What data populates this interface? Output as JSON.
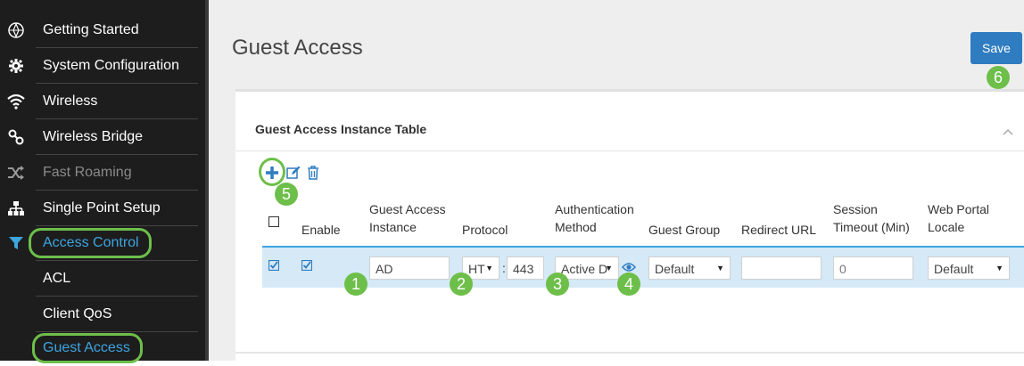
{
  "sidebar": {
    "items": [
      {
        "label": "Getting Started",
        "icon": "compass-icon"
      },
      {
        "label": "System Configuration",
        "icon": "gear-icon"
      },
      {
        "label": "Wireless",
        "icon": "wifi-icon"
      },
      {
        "label": "Wireless Bridge",
        "icon": "bridge-icon"
      },
      {
        "label": "Fast Roaming",
        "icon": "shuffle-icon"
      },
      {
        "label": "Single Point Setup",
        "icon": "hierarchy-icon"
      },
      {
        "label": "Access Control",
        "icon": "filter-icon"
      },
      {
        "label": "ACL"
      },
      {
        "label": "Client QoS"
      },
      {
        "label": "Guest Access"
      }
    ]
  },
  "page": {
    "title": "Guest Access",
    "save_label": "Save"
  },
  "panel": {
    "title": "Guest Access Instance Table",
    "headers": {
      "enable": "Enable",
      "instance_1": "Guest Access",
      "instance_2": "Instance",
      "protocol": "Protocol",
      "auth_1": "Authentication",
      "auth_2": "Method",
      "guest_group": "Guest Group",
      "redirect_url": "Redirect URL",
      "timeout_1": "Session",
      "timeout_2": "Timeout (Min)",
      "locale_1": "Web Portal",
      "locale_2": "Locale"
    },
    "row": {
      "instance": "AD",
      "protocol": "HTTPS",
      "protocol_shown": "HT",
      "port_sep": ":",
      "port": "443",
      "auth_method": "Active D",
      "guest_group": "Default",
      "redirect_url": "",
      "session_timeout": "0",
      "locale": "Default"
    }
  },
  "callouts": [
    "1",
    "2",
    "3",
    "4",
    "5",
    "6"
  ],
  "colors": {
    "accent": "#3da5e0",
    "callout": "#6dbf4a",
    "save": "#2f7cc1",
    "sidebar": "#1d1d1d"
  }
}
